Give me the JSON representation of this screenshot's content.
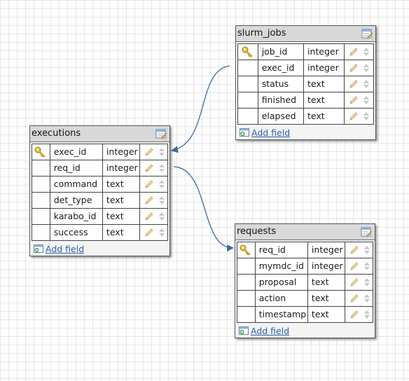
{
  "tables": {
    "slurm_jobs": {
      "title": "slurm_jobs",
      "add_field": "Add field",
      "fields": [
        {
          "name": "job_id",
          "type": "integer",
          "key": true
        },
        {
          "name": "exec_id",
          "type": "integer",
          "key": false
        },
        {
          "name": "status",
          "type": "text",
          "key": false
        },
        {
          "name": "finished",
          "type": "text",
          "key": false
        },
        {
          "name": "elapsed",
          "type": "text",
          "key": false
        }
      ]
    },
    "executions": {
      "title": "executions",
      "add_field": "Add field",
      "fields": [
        {
          "name": "exec_id",
          "type": "integer",
          "key": true
        },
        {
          "name": "req_id",
          "type": "integer",
          "key": false
        },
        {
          "name": "command",
          "type": "text",
          "key": false
        },
        {
          "name": "det_type",
          "type": "text",
          "key": false
        },
        {
          "name": "karabo_id",
          "type": "text",
          "key": false
        },
        {
          "name": "success",
          "type": "text",
          "key": false
        }
      ]
    },
    "requests": {
      "title": "requests",
      "add_field": "Add field",
      "fields": [
        {
          "name": "req_id",
          "type": "integer",
          "key": true
        },
        {
          "name": "mymdc_id",
          "type": "integer",
          "key": false
        },
        {
          "name": "proposal",
          "type": "text",
          "key": false
        },
        {
          "name": "action",
          "type": "text",
          "key": false
        },
        {
          "name": "timestamp",
          "type": "text",
          "key": false
        }
      ]
    }
  },
  "colors": {
    "connector": "#3b6aa0",
    "link": "#2a5fa8"
  },
  "icons": {
    "primary_key": "key-icon",
    "edit_table": "edit-table-icon",
    "edit_field": "pencil-icon",
    "reorder": "up-down-arrows-icon",
    "add_field": "add-field-icon"
  }
}
